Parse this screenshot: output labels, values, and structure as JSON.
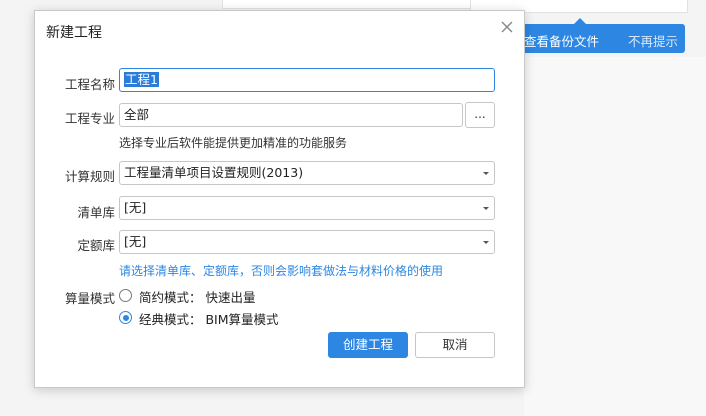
{
  "backup_banner": {
    "view_label": "查看备份文件",
    "dismiss_label": "不再提示"
  },
  "dialog": {
    "title": "新建工程",
    "close_icon": "close-icon",
    "project_name": {
      "label": "工程名称",
      "value": "工程1"
    },
    "project_discipline": {
      "label": "工程专业",
      "value": "全部",
      "browse_label": "..."
    },
    "discipline_hint": "选择专业后软件能提供更加精准的功能服务",
    "calc_rules": {
      "label": "计算规则",
      "value": "工程量清单项目设置规则(2013)"
    },
    "bill_library": {
      "label": "清单库",
      "value": "[无]"
    },
    "quota_library": {
      "label": "定额库",
      "value": "[无]"
    },
    "library_warning": "请选择清单库、定额库，否则会影响套做法与材料价格的使用",
    "calc_mode": {
      "label": "算量模式",
      "options": [
        {
          "label": "简约模式：  快速出量",
          "checked": false
        },
        {
          "label": "经典模式：  BIM算量模式",
          "checked": true
        }
      ]
    },
    "create_button": "创建工程",
    "cancel_button": "取消"
  },
  "colors": {
    "accent": "#2d87e2",
    "selection": "#2b7bd9",
    "warning_text": "#2d87e2"
  }
}
